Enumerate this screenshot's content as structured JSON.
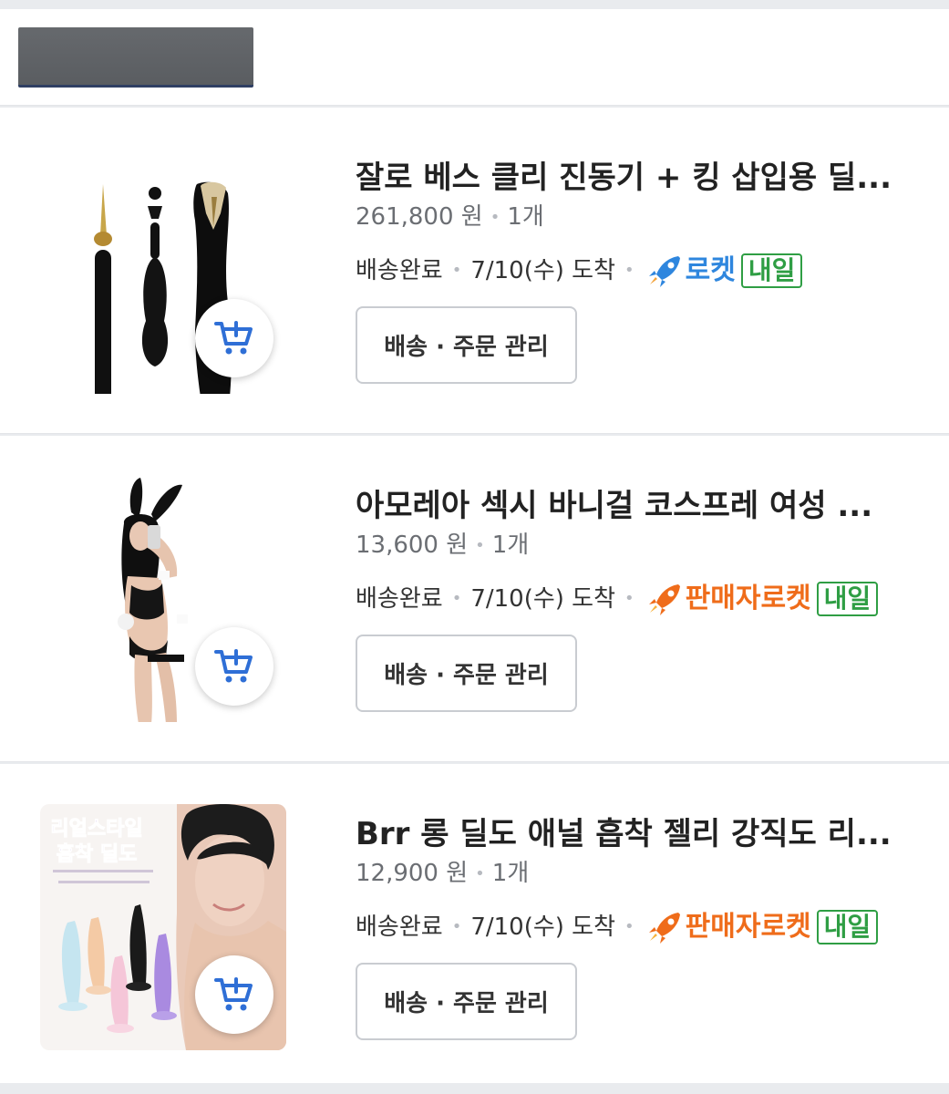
{
  "orders": [
    {
      "title": "잘로 베스 클리 진동기 + 킹 삽입용 딜...",
      "price": "261,800 원",
      "quantity": "1개",
      "status": "배송완료",
      "arrival": "7/10(수) 도착",
      "badge_label": "로켓",
      "badge_tomorrow": "내일",
      "manage_label": "배송 · 주문 관리",
      "badge_color": "#2e86de"
    },
    {
      "title": "아모레아 섹시 바니걸 코스프레 여성 ...",
      "price": "13,600 원",
      "quantity": "1개",
      "status": "배송완료",
      "arrival": "7/10(수) 도착",
      "badge_label": "판매자로켓",
      "badge_tomorrow": "내일",
      "manage_label": "배송 · 주문 관리",
      "badge_color": "#ef6c1a"
    },
    {
      "title": "Brr 롱 딜도 애널 흡착 젤리 강직도 리...",
      "price": "12,900 원",
      "quantity": "1개",
      "status": "배송완료",
      "arrival": "7/10(수) 도착",
      "badge_label": "판매자로켓",
      "badge_tomorrow": "내일",
      "manage_label": "배송 · 주문 관리",
      "badge_color": "#ef6c1a",
      "image_text_line1": "리얼스타일",
      "image_text_line2": "흡착 딜도"
    }
  ],
  "icons": {
    "cart": "add-to-cart-icon",
    "rocket": "rocket-icon"
  }
}
